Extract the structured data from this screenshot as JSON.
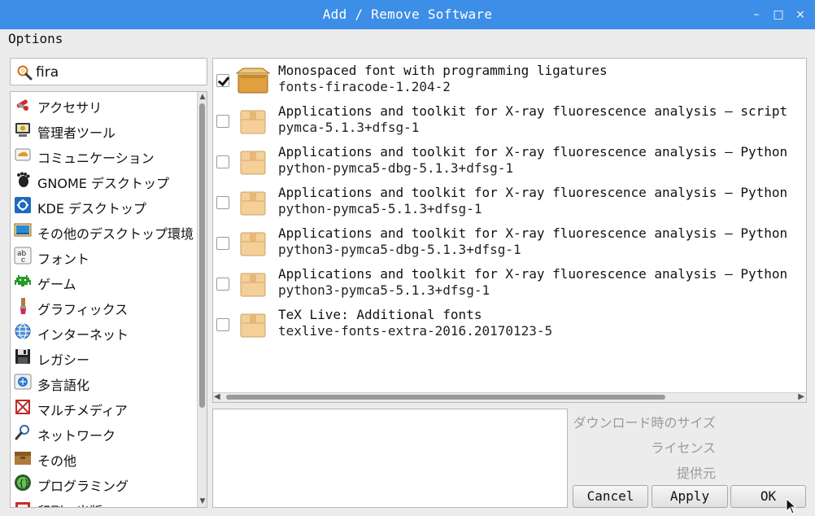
{
  "window": {
    "title": "Add / Remove Software",
    "minimize_glyph": "–",
    "maximize_glyph": "□",
    "close_glyph": "×"
  },
  "menu": {
    "options_label": "Options"
  },
  "search": {
    "value": "fira",
    "icon": "search-icon"
  },
  "categories": [
    {
      "label": "アクセサリ",
      "icon": "accessories-icon"
    },
    {
      "label": "管理者ツール",
      "icon": "admin-tools-icon"
    },
    {
      "label": "コミュニケーション",
      "icon": "communication-icon"
    },
    {
      "label": "GNOME デスクトップ",
      "icon": "gnome-icon"
    },
    {
      "label": "KDE デスクトップ",
      "icon": "kde-icon"
    },
    {
      "label": "その他のデスクトップ環境",
      "icon": "desktop-environment-icon"
    },
    {
      "label": "フォント",
      "icon": "font-icon"
    },
    {
      "label": "ゲーム",
      "icon": "game-icon"
    },
    {
      "label": "グラフィックス",
      "icon": "graphics-icon"
    },
    {
      "label": "インターネット",
      "icon": "internet-icon"
    },
    {
      "label": "レガシー",
      "icon": "legacy-icon"
    },
    {
      "label": "多言語化",
      "icon": "localization-icon"
    },
    {
      "label": "マルチメディア",
      "icon": "multimedia-icon"
    },
    {
      "label": "ネットワーク",
      "icon": "network-icon"
    },
    {
      "label": "その他",
      "icon": "other-icon"
    },
    {
      "label": "プログラミング",
      "icon": "programming-icon"
    },
    {
      "label": "印刷・出版",
      "icon": "publishing-icon"
    }
  ],
  "packages": [
    {
      "description": "Monospaced font with programming ligatures",
      "name": "fonts-firacode-1.204-2",
      "checked": true,
      "installed": true
    },
    {
      "description": "Applications and toolkit for X-ray fluorescence analysis — script",
      "name": "pymca-5.1.3+dfsg-1",
      "checked": false,
      "installed": false
    },
    {
      "description": "Applications and toolkit for X-ray fluorescence analysis — Python",
      "name": "python-pymca5-dbg-5.1.3+dfsg-1",
      "checked": false,
      "installed": false
    },
    {
      "description": "Applications and toolkit for X-ray fluorescence analysis — Python",
      "name": "python-pymca5-5.1.3+dfsg-1",
      "checked": false,
      "installed": false
    },
    {
      "description": "Applications and toolkit for X-ray fluorescence analysis — Python",
      "name": "python3-pymca5-dbg-5.1.3+dfsg-1",
      "checked": false,
      "installed": false
    },
    {
      "description": "Applications and toolkit for X-ray fluorescence analysis — Python",
      "name": "python3-pymca5-5.1.3+dfsg-1",
      "checked": false,
      "installed": false
    },
    {
      "description": "TeX Live: Additional fonts",
      "name": "texlive-fonts-extra-2016.20170123-5",
      "checked": false,
      "installed": false
    }
  ],
  "info_labels": {
    "download_size": "ダウンロード時のサイズ",
    "license": "ライセンス",
    "provider": "提供元"
  },
  "buttons": {
    "cancel": "Cancel",
    "apply": "Apply",
    "ok": "OK"
  },
  "colors": {
    "titlebar": "#3d8ee6",
    "window_bg": "#ececec",
    "package_box": "#f0c98f"
  }
}
